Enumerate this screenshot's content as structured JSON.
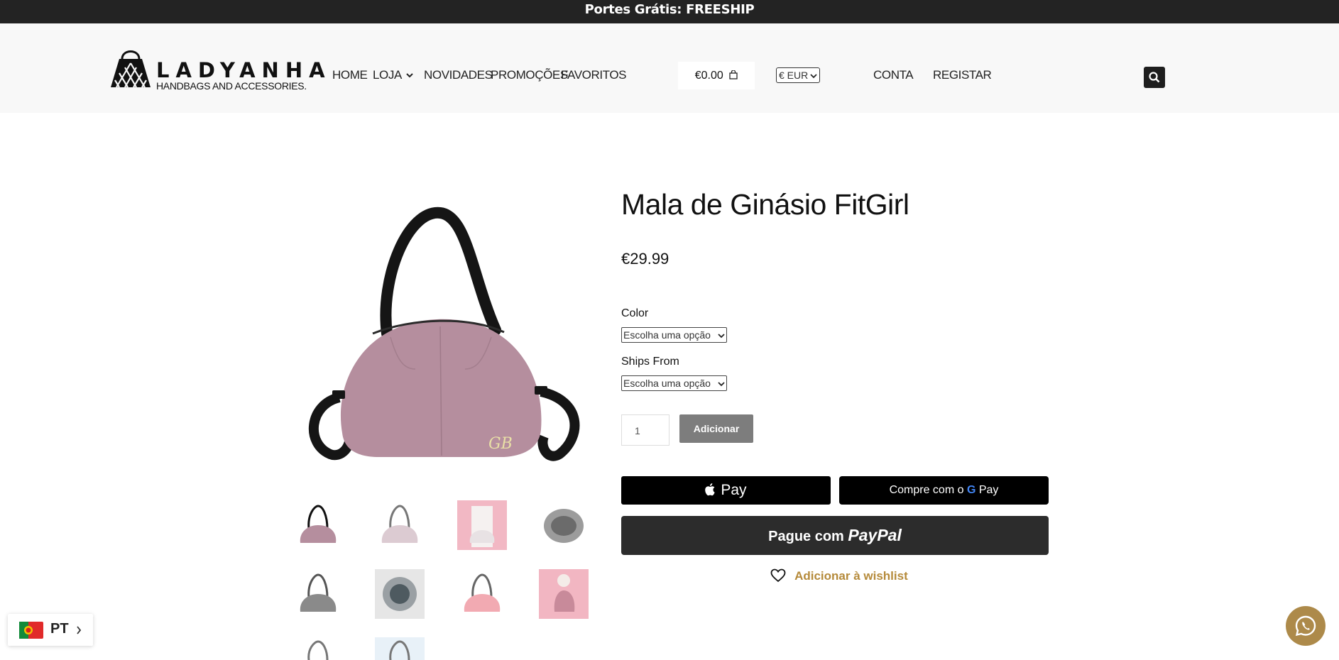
{
  "announcement": {
    "text": "Portes Grátis: FREESHIP"
  },
  "logo": {
    "word": "LADYANHA",
    "tagline": "HANDBAGS AND ACCESSORIES."
  },
  "nav": {
    "items": [
      {
        "label": "HOME"
      },
      {
        "label": "LOJA"
      },
      {
        "label": "NOVIDADES"
      },
      {
        "label": "PROMOÇÕES"
      },
      {
        "label": "FAVORITOS"
      }
    ],
    "account": "CONTA",
    "register": "REGISTAR"
  },
  "cart": {
    "total": "€0.00"
  },
  "currency": {
    "selected": "€ EUR"
  },
  "product": {
    "title": "Mala de Ginásio FitGirl",
    "price": "€29.99",
    "variants": [
      {
        "label": "Color",
        "value": "Escolha uma opção"
      },
      {
        "label": "Ships From",
        "value": "Escolha uma opção"
      }
    ],
    "quantity": "1",
    "add_label": "Adicionar",
    "apple_pay_label": "Pay",
    "google_pay_prefix": "Compre com o",
    "google_pay_label": "Pay",
    "paypal_prefix": "Pague com",
    "paypal_brand": "PayPal",
    "wishlist_label": "Adicionar à wishlist",
    "thumbnails": [
      "thumb-1",
      "thumb-2",
      "thumb-3",
      "thumb-4",
      "thumb-5",
      "thumb-6",
      "thumb-7",
      "thumb-8",
      "thumb-9",
      "thumb-10"
    ]
  },
  "language": {
    "code": "PT"
  },
  "colors": {
    "topbar": "#232323",
    "header": "#f8f8f8",
    "accent_gold": "#b58a3a",
    "whatsapp_bg": "#ad8a4a",
    "bag_pink": "#b58e9e"
  }
}
